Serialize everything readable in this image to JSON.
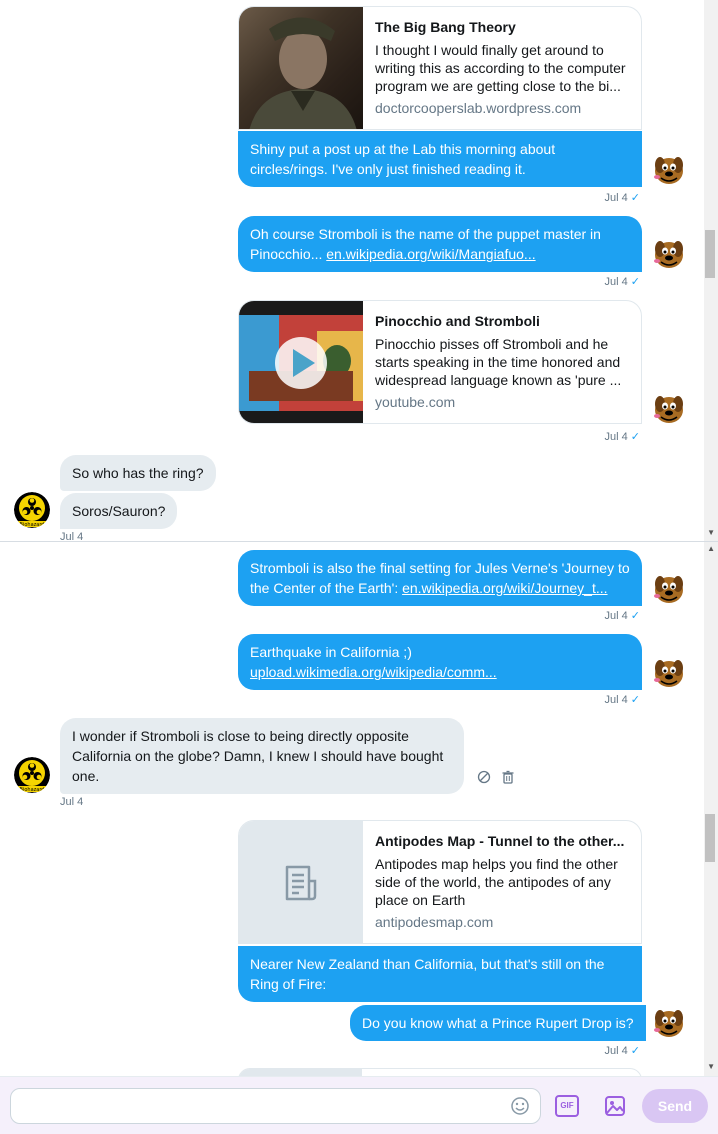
{
  "messages": {
    "card1": {
      "title": "The Big Bang Theory",
      "description": "I thought I would finally get around to writing this as according to the computer program we are getting close to the bi...",
      "domain": "doctorcooperslab.wordpress.com"
    },
    "msg1": {
      "text": "Shiny put a post up at the Lab this morning about circles/rings. I've only just finished reading it.",
      "time": "Jul 4"
    },
    "msg2": {
      "text": "Oh course Stromboli is the name of the puppet master in Pinocchio... ",
      "link": "en.wikipedia.org/wiki/Mangiafuo...",
      "time": "Jul 4"
    },
    "card2": {
      "title": "Pinocchio and Stromboli",
      "description": "Pinocchio pisses off Stromboli and he starts speaking in the time honored and widespread language known as 'pure ...",
      "domain": "youtube.com",
      "time": "Jul 4"
    },
    "in1": {
      "text": "So who has the ring?"
    },
    "in2": {
      "text": "Soros/Sauron?",
      "time": "Jul 4"
    },
    "msg3": {
      "text": "Stromboli is also the final setting for Jules Verne's 'Journey to the Center of the Earth': ",
      "link": "en.wikipedia.org/wiki/Journey_t...",
      "time": "Jul 4"
    },
    "msg4": {
      "text": "Earthquake in California ;)",
      "link": "upload.wikimedia.org/wikipedia/comm...",
      "time": "Jul 4"
    },
    "in3": {
      "text": "I wonder if Stromboli is close to being directly opposite California on the globe? Damn, I knew I should have bought one.",
      "time": "Jul 4"
    },
    "card3": {
      "title": "Antipodes Map - Tunnel to the other...",
      "description": "Antipodes map helps you find the other side of the world, the antipodes of any place on Earth",
      "domain": "antipodesmap.com"
    },
    "msg5": {
      "text": "Nearer New Zealand than California, but that's still on the Ring of Fire:"
    },
    "msg6": {
      "text": "Do you know what a Prince Rupert Drop is?",
      "time": "Jul 4"
    }
  },
  "composer": {
    "placeholder": "",
    "send_label": "Send",
    "gif_label": "GIF"
  },
  "avatar_badge": "Biohazard",
  "colors": {
    "accent": "#1da1f2",
    "incoming": "#e6ecf0",
    "send_disabled": "#d9c6f3"
  }
}
